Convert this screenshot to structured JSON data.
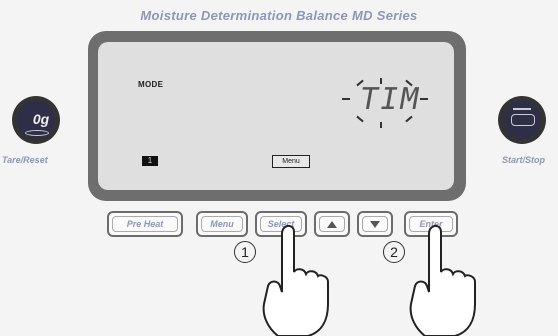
{
  "header": {
    "title": "Moisture Determination Balance MD Series"
  },
  "display": {
    "mode_label": "MODE",
    "segment_text": "TIM",
    "indicator_1": "1",
    "indicator_menu": "Menu"
  },
  "side_buttons": {
    "left_icon_text": "0g",
    "left_label": "Tare/Reset",
    "right_label": "Start/Stop"
  },
  "keys": {
    "preheat": "Pre Heat",
    "menu": "Menu",
    "select": "Select",
    "up": "▲",
    "down": "▼",
    "enter": "Enter"
  },
  "steps": {
    "step1": "1",
    "step2": "2"
  },
  "colors": {
    "label_color": "#8f96b8",
    "bezel": "#6e6e6e",
    "lcd": "#dfdfdf"
  }
}
